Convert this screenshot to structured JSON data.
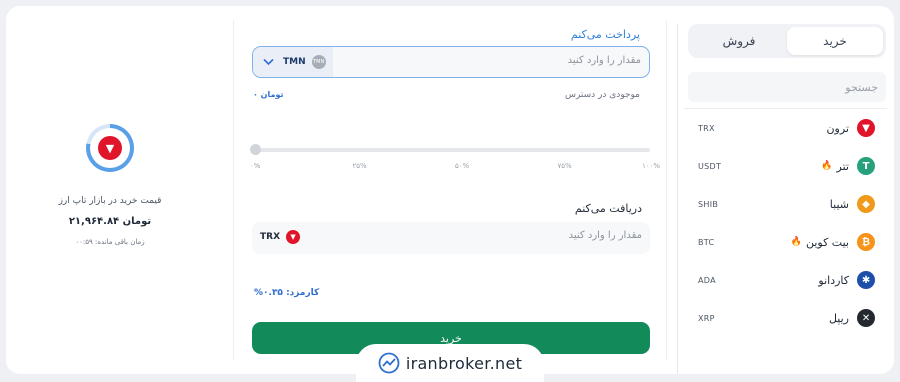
{
  "tabs": {
    "buy": "خرید",
    "sell": "فروش"
  },
  "search": {
    "placeholder": "جستجو"
  },
  "coins": [
    {
      "name": "ترون",
      "symbol": "TRX",
      "icon": "tron-icon",
      "color": "#e0152a",
      "glyph": "▼",
      "hot": false
    },
    {
      "name": "تتر",
      "symbol": "USDT",
      "icon": "tether-icon",
      "color": "#26a17b",
      "glyph": "T",
      "hot": true
    },
    {
      "name": "شیبا",
      "symbol": "SHIB",
      "icon": "shiba-icon",
      "color": "#f09a1b",
      "glyph": "◆",
      "hot": false
    },
    {
      "name": "بیت کوین",
      "symbol": "BTC",
      "icon": "bitcoin-icon",
      "color": "#f7931a",
      "glyph": "₿",
      "hot": true
    },
    {
      "name": "کاردانو",
      "symbol": "ADA",
      "icon": "cardano-icon",
      "color": "#1e4fa8",
      "glyph": "✱",
      "hot": false
    },
    {
      "name": "ریپل",
      "symbol": "XRP",
      "icon": "ripple-icon",
      "color": "#23292f",
      "glyph": "✕",
      "hot": false
    }
  ],
  "form": {
    "pay_label": "پرداخت می‌کنم",
    "pay_placeholder": "مقدار را وارد کنید",
    "pay_currency": "TMN",
    "available_label": "موجودی در دسترس",
    "available_value": "۰ تومان",
    "slider_value": 0,
    "slider_ticks": [
      "۰%",
      "۲۵%",
      "۵۰%",
      "۷۵%",
      "۱۰۰%"
    ],
    "receive_label": "دریافت می‌کنم",
    "receive_placeholder": "مقدار را وارد کنید",
    "receive_currency": "TRX",
    "fee": "کارمزد: ۰.۳۵%",
    "buy_button": "خرید"
  },
  "price": {
    "title": "قیمت خرید در بازار تاپ ارز",
    "value": "۲۱,۹۶۴.۸۴ تومان",
    "timer": "زمان باقی مانده: ۰۰:۵۹",
    "timer_progress": 0.78
  },
  "watermark": "iranbroker.net",
  "colors": {
    "accent": "#2f7fd8",
    "buy": "#128a5a",
    "tron": "#e0152a"
  }
}
